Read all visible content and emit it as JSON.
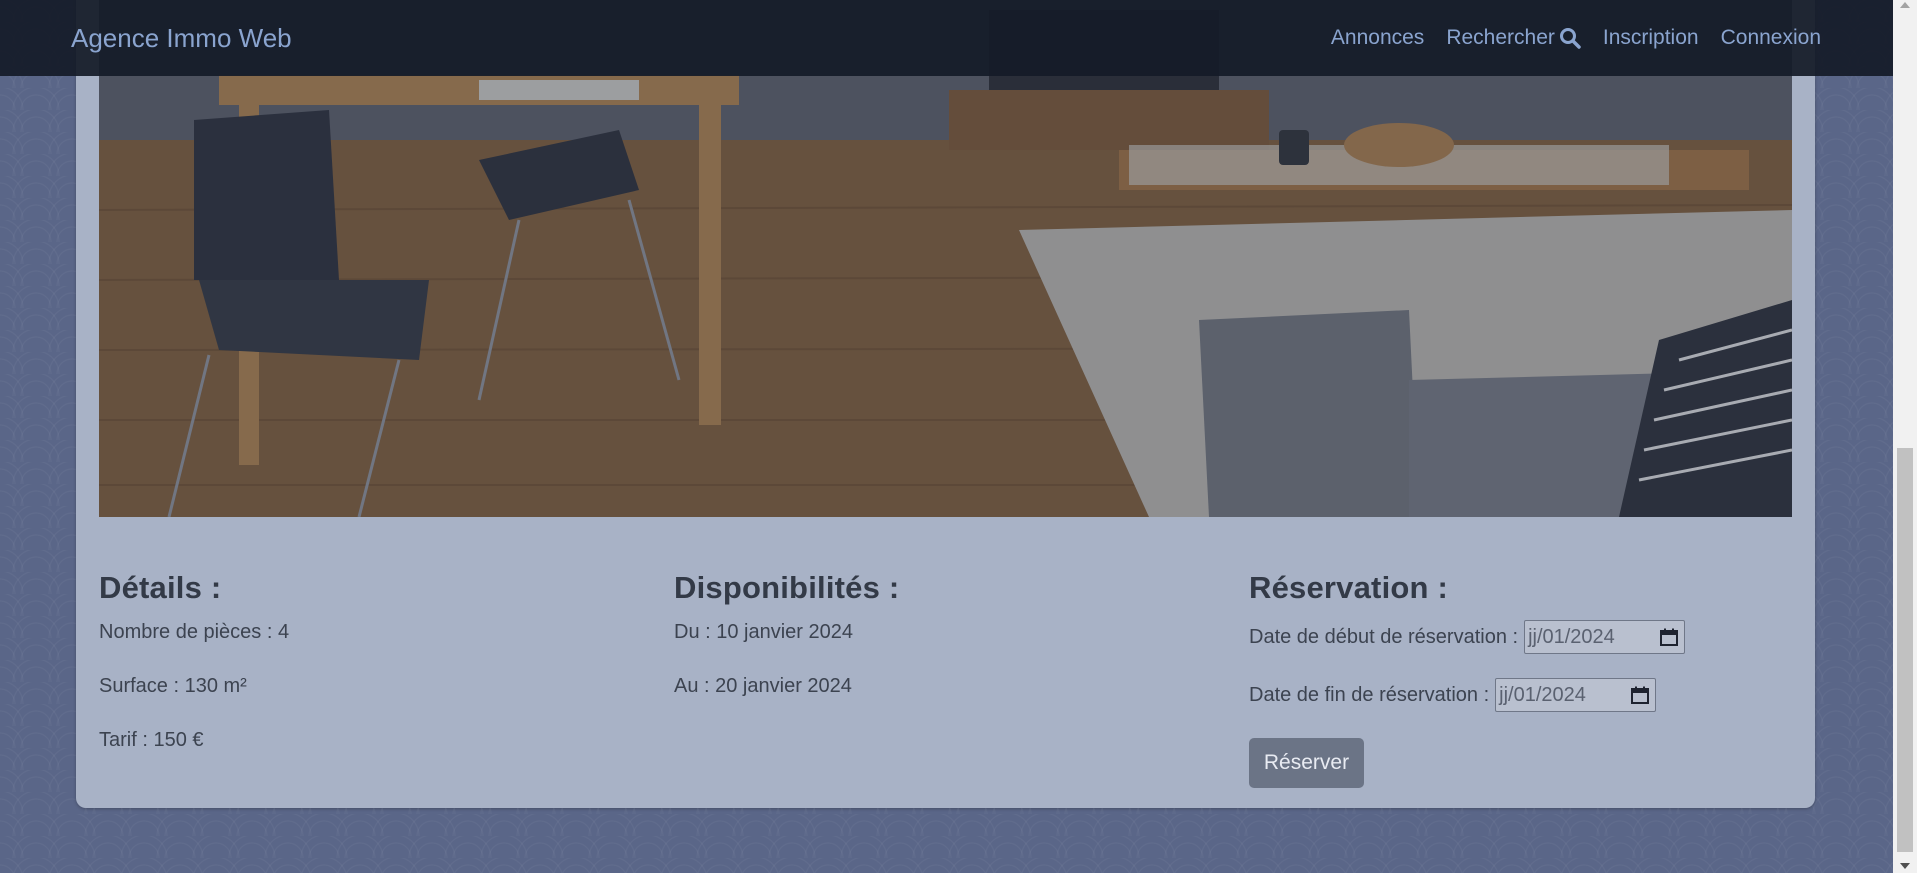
{
  "navbar": {
    "brand": "Agence Immo Web",
    "links": [
      {
        "label": "Annonces"
      },
      {
        "label": "Rechercher",
        "icon": "search-icon"
      },
      {
        "label": "Inscription"
      },
      {
        "label": "Connexion"
      }
    ]
  },
  "details": {
    "title": "Détails :",
    "rooms": "Nombre de pièces : 4",
    "surface": "Surface : 130 m²",
    "price": "Tarif : 150 €"
  },
  "availability": {
    "title": "Disponibilités :",
    "from": "Du : 10 janvier 2024",
    "to": "Au : 20 janvier 2024"
  },
  "reservation": {
    "title": "Réservation :",
    "start_label": "Date de début de réservation :",
    "start_value": "jj/01/2024",
    "end_label": "Date de fin de réservation :",
    "end_value": "jj/01/2024",
    "button": "Réserver"
  },
  "colors": {
    "navbar_bg": "#141b28",
    "link": "#8aa4cf",
    "card_bg": "#a8b2c6",
    "button_bg": "#6b7486"
  }
}
